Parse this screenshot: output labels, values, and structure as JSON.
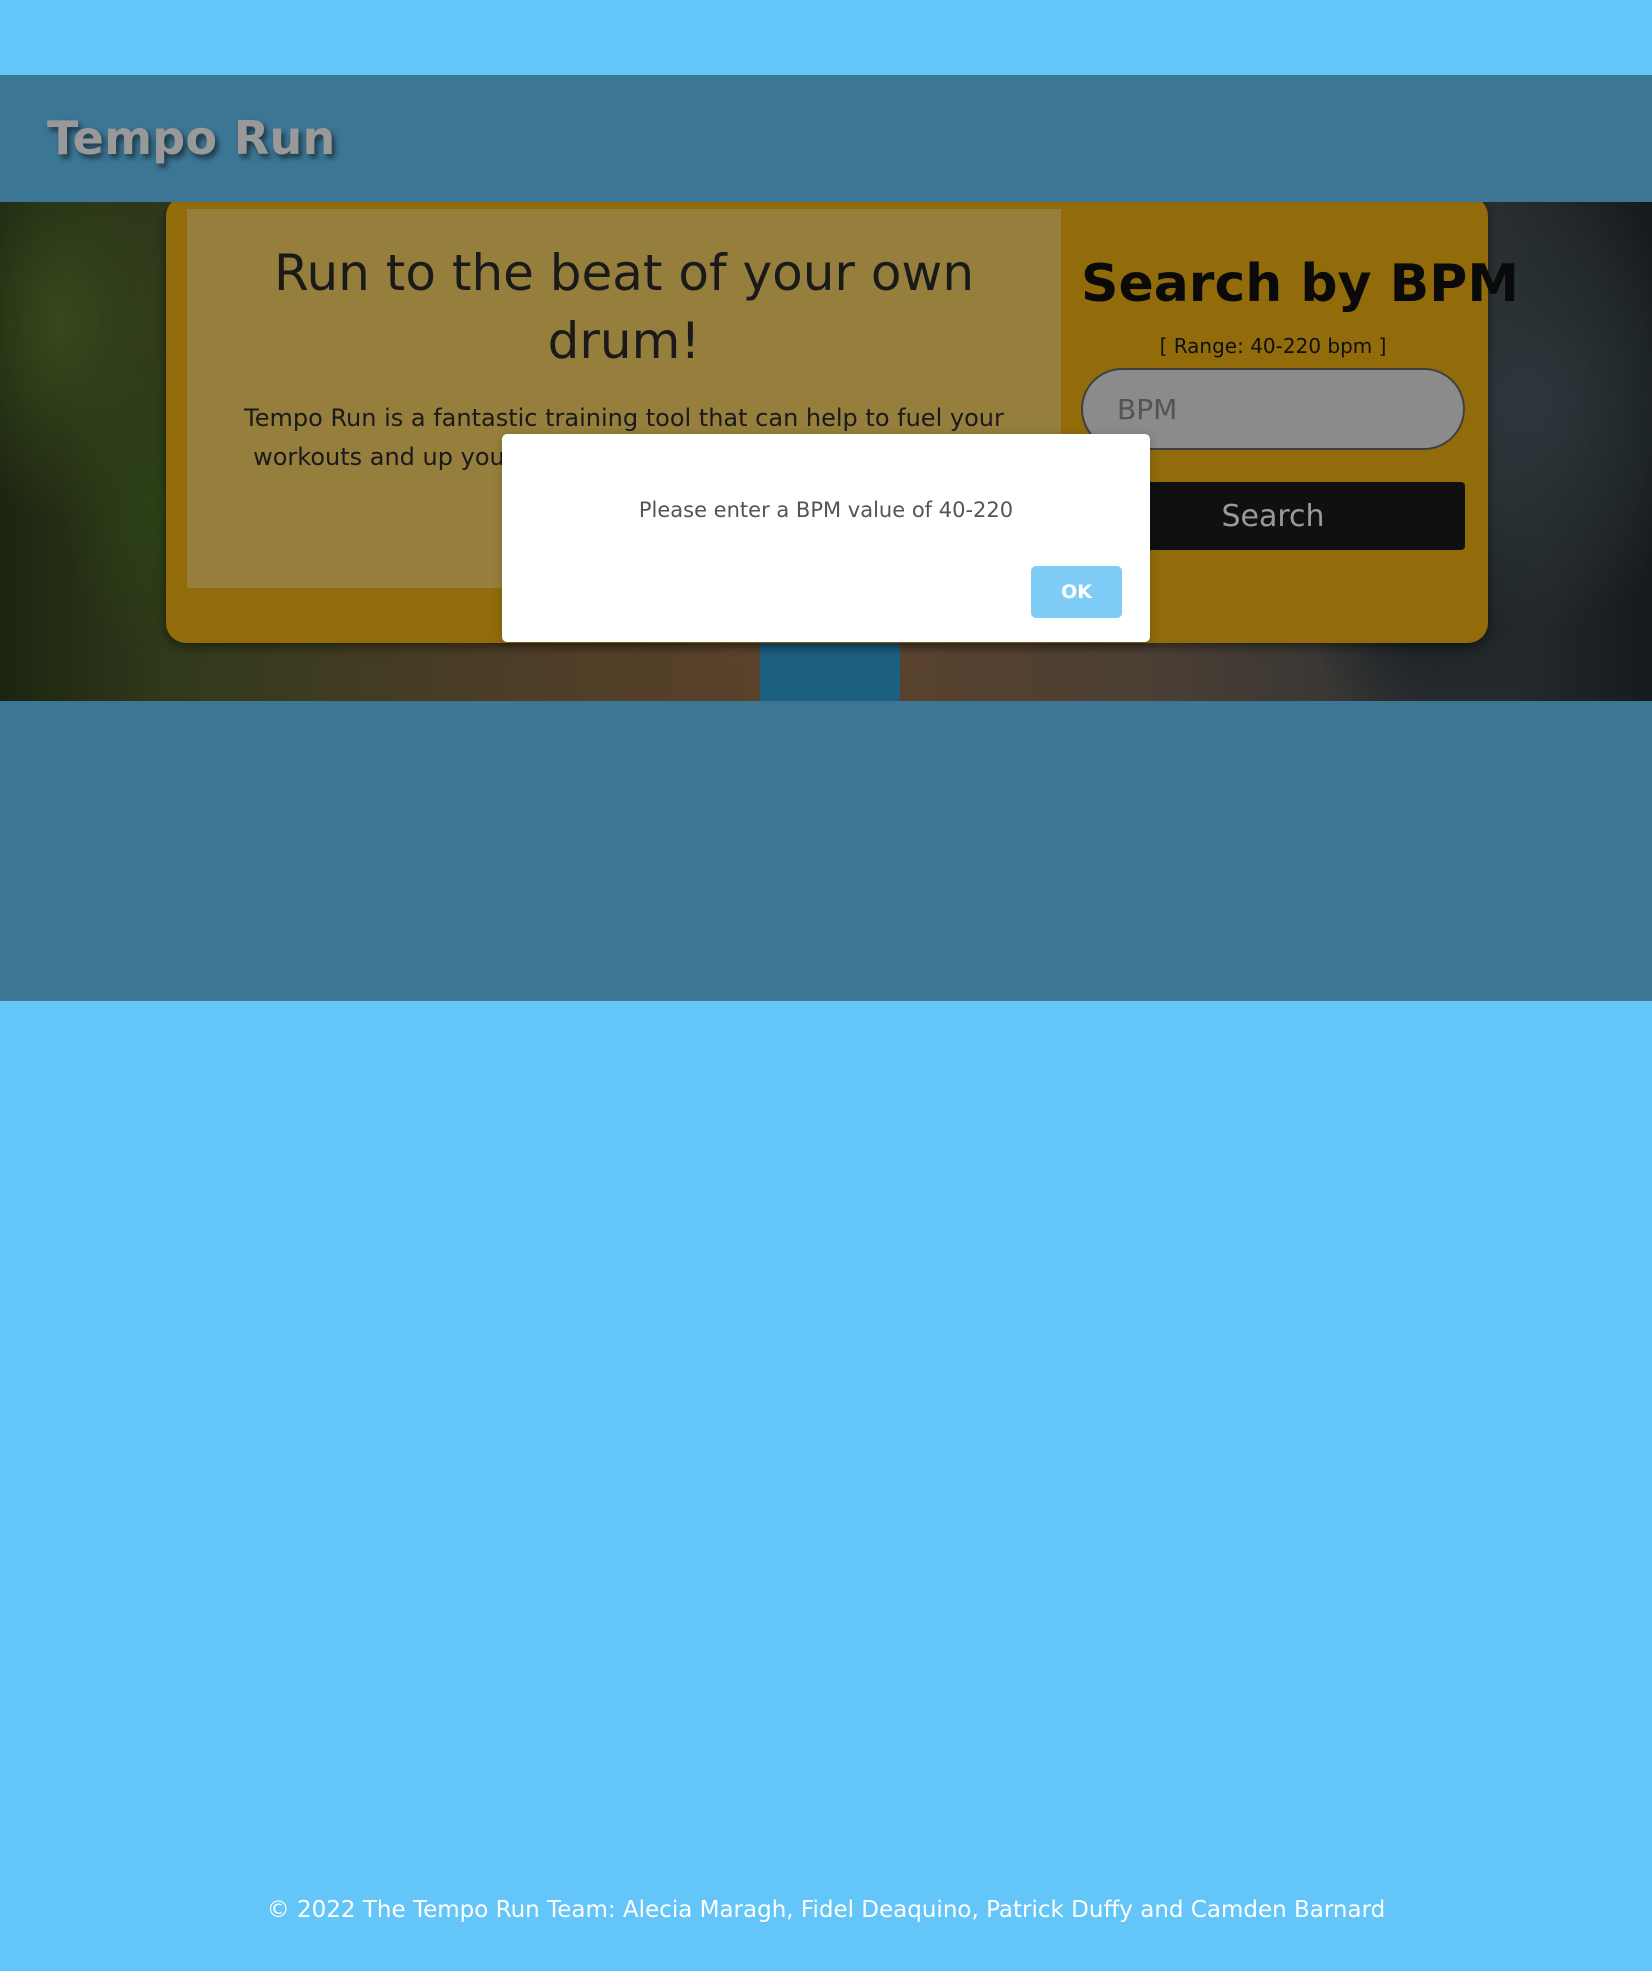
{
  "header": {
    "brand": "Tempo Run"
  },
  "intro": {
    "title": "Run to the beat of your own drum!",
    "text": "Tempo Run is a fantastic training tool that can help to fuel your workouts and up your t... of their target bpm and ... to stay ..."
  },
  "search": {
    "title": "Search by BPM",
    "range": "[ Range: 40-220 bpm ]",
    "placeholder": "BPM",
    "button_label": "Search"
  },
  "dialog": {
    "message": "Please enter a BPM value of 40-220",
    "ok_label": "OK"
  },
  "footer": {
    "text": "© 2022 The Tempo Run Team: Alecia Maragh, Fidel Deaquino, Patrick Duffy and Camden Barnard"
  },
  "colors": {
    "page_background": "#64c5f8",
    "card_background": "#f4b513",
    "button_dark": "#1b1b1b",
    "ok_button": "#7fcdf6"
  }
}
